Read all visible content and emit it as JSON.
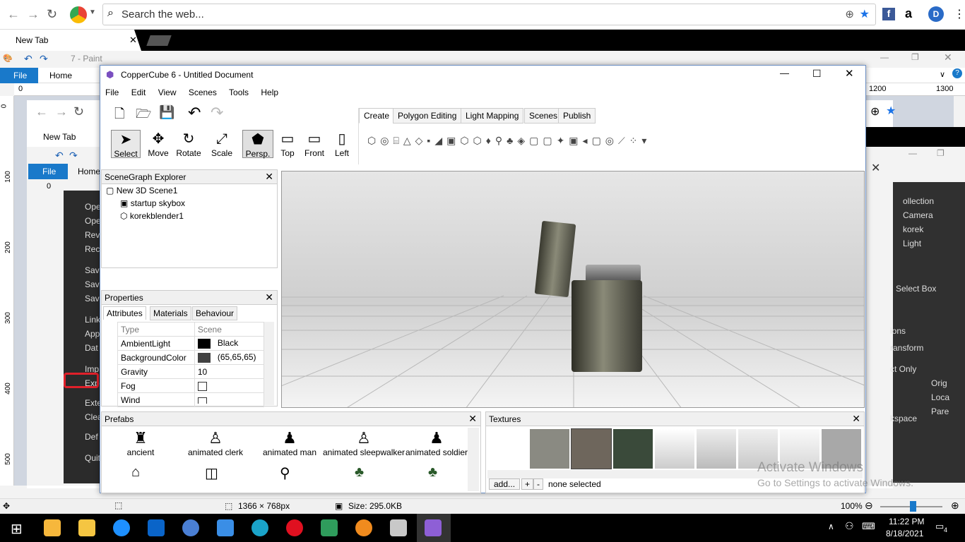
{
  "browser": {
    "search_placeholder": "Search the web...",
    "tab_label": "New Tab"
  },
  "paint": {
    "title": "7 - Paint",
    "file": "File",
    "home": "Home",
    "ruler_left": "0",
    "ruler_1200": "1200",
    "ruler_1300": "1300",
    "vruler": [
      "0",
      "100",
      "200",
      "300",
      "400",
      "500"
    ],
    "inner_tab_label": "New Tab",
    "inner_file": "File",
    "inner_home": "Home",
    "inner_ruler_0": "0",
    "inner_vruler": [
      "200",
      "300",
      "400",
      "500"
    ],
    "menu_items": [
      "Ope",
      "Ope",
      "Rev",
      "Rec",
      "Sav",
      "Sav",
      "Sav",
      "Link",
      "App",
      "Dat",
      "Imp",
      "Exp",
      "Exte",
      "Clea",
      "Def",
      "Quit"
    ],
    "status": {
      "dimensions": "1366 × 768px",
      "size": "Size: 295.0KB",
      "zoom": "100%"
    }
  },
  "blender": {
    "ruler": "1200",
    "items": [
      "ollection",
      "Camera",
      "korek",
      "Light",
      "Select Box",
      "ions",
      "ransform",
      "ct Only",
      "Orig",
      "Loca",
      "Pare",
      "kspace"
    ]
  },
  "coppercube": {
    "title": "CopperCube 6 - Untitled Document",
    "menu": [
      "File",
      "Edit",
      "View",
      "Scenes",
      "Tools",
      "Help"
    ],
    "tools": [
      "Select",
      "Move",
      "Rotate",
      "Scale",
      "Persp.",
      "Top",
      "Front",
      "Left"
    ],
    "tabs": [
      "Create",
      "Polygon Editing",
      "Light Mapping",
      "Scenes",
      "Publish"
    ],
    "scenegraph": {
      "title": "SceneGraph Explorer",
      "items": [
        "New 3D Scene1",
        "startup skybox",
        "korekblender1"
      ]
    },
    "properties": {
      "title": "Properties",
      "tabs": [
        "Attributes",
        "Materials",
        "Behaviour"
      ],
      "rows": [
        {
          "name": "Type",
          "value": "Scene"
        },
        {
          "name": "AmbientLight",
          "value": "Black"
        },
        {
          "name": "BackgroundColor",
          "value": "(65,65,65)"
        },
        {
          "name": "Gravity",
          "value": "10"
        },
        {
          "name": "Fog",
          "value": ""
        },
        {
          "name": "Wind",
          "value": ""
        }
      ]
    },
    "prefabs": {
      "title": "Prefabs",
      "items": [
        "ancient",
        "animated clerk",
        "animated man",
        "animated sleepwalker",
        "animated soldier"
      ]
    },
    "textures": {
      "title": "Textures",
      "add": "add...",
      "plus": "+",
      "minus": "-",
      "status": "none selected"
    }
  },
  "watermark": {
    "line1": "Activate Windows",
    "line2": "Go to Settings to activate Windows."
  },
  "taskbar": {
    "time": "11:22 PM",
    "date": "8/18/2021",
    "notif": "4"
  }
}
